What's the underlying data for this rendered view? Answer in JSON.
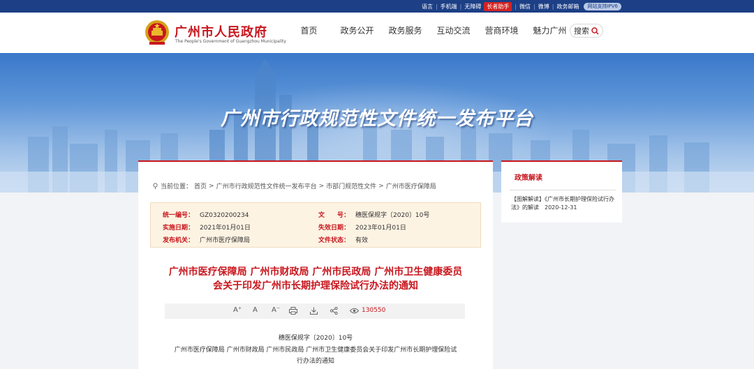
{
  "topbar": {
    "links": [
      "语言",
      "手机端",
      "无障碍",
      "长者助手",
      "微信",
      "微博",
      "政务邮箱"
    ],
    "ipv6": "网站支持IPV6"
  },
  "header": {
    "title": "广州市人民政府",
    "subtitle": "The People's Government of Guangzhou Municipality",
    "nav": [
      "首页",
      "政务公开",
      "政务服务",
      "互动交流",
      "营商环境",
      "魅力广州"
    ],
    "search_label": "搜索"
  },
  "banner": {
    "title": "广州市行政规范性文件统一发布平台"
  },
  "breadcrumb": {
    "prefix": "当前位置：",
    "items": [
      "首页",
      "广州市行政规范性文件统一发布平台",
      "市部门规范性文件",
      "广州市医疗保障局"
    ],
    "sep": ">"
  },
  "meta": {
    "unified_no_label": "统一编号：",
    "unified_no": "GZ0320200234",
    "doc_no_label": "文　　号：",
    "doc_no": "穗医保规字〔2020〕10号",
    "effective_label": "实施日期：",
    "effective": "2021年01月01日",
    "expire_label": "失效日期：",
    "expire": "2023年01月01日",
    "issuer_label": "发布机关：",
    "issuer": "广州市医疗保障局",
    "status_label": "文件状态：",
    "status": "有效"
  },
  "document": {
    "title_line1": "广州市医疗保障局 广州市财政局 广州市民政局 广州市卫生健康委员",
    "title_line2": "会关于印发广州市长期护理保险试行办法的通知",
    "views": "130550",
    "doc_ref": "穗医保规字〔2020〕10号",
    "body_line1": "广州市医疗保障局 广州市财政局 广州市民政局 广州市卫生健康委员会关于印发广州市长期护理保险试",
    "body_line2": "行办法的通知"
  },
  "toolbar": {
    "font_larger": "A⁺",
    "font_normal": "A",
    "font_smaller": "A⁻"
  },
  "side": {
    "title": "政策解读",
    "item": "【图解解读】《广州市长期护理保险试行办法》的解读　2020-12-31"
  }
}
